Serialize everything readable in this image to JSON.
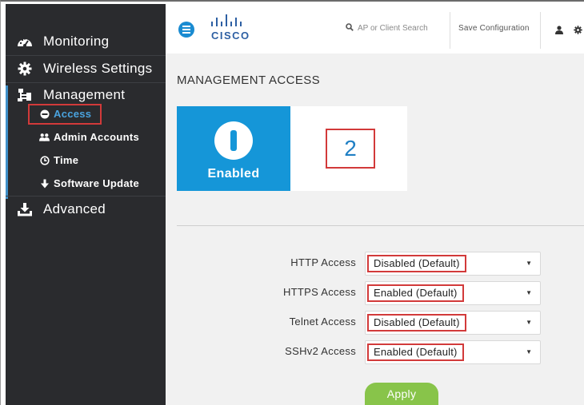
{
  "sidebar": {
    "items": [
      {
        "label": "Monitoring",
        "icon": "dashboard-icon"
      },
      {
        "label": "Wireless Settings",
        "icon": "gear-icon"
      },
      {
        "label": "Management",
        "icon": "sitemap-icon"
      },
      {
        "label": "Advanced",
        "icon": "download-icon"
      }
    ],
    "management_sub": [
      {
        "label": "Access",
        "icon": "minus-circle-icon",
        "active": true
      },
      {
        "label": "Admin Accounts",
        "icon": "users-icon"
      },
      {
        "label": "Time",
        "icon": "clock-icon"
      },
      {
        "label": "Software Update",
        "icon": "arrow-down-icon"
      }
    ]
  },
  "header": {
    "logo_text": "CISCO",
    "search_placeholder": "AP or Client Search",
    "save_label": "Save Configuration"
  },
  "main": {
    "title": "MANAGEMENT ACCESS",
    "tile": {
      "label": "Enabled"
    },
    "callout": "2",
    "form": [
      {
        "label": "HTTP Access",
        "value": "Disabled (Default)"
      },
      {
        "label": "HTTPS Access",
        "value": "Enabled (Default)"
      },
      {
        "label": "Telnet Access",
        "value": "Disabled (Default)"
      },
      {
        "label": "SSHv2 Access",
        "value": "Enabled (Default)"
      }
    ],
    "apply_label": "Apply"
  },
  "colors": {
    "sidebar_bg": "#2a2b2e",
    "accent_blue": "#1596d8",
    "highlight_red": "#d23a3a",
    "apply_green": "#88c44a"
  }
}
